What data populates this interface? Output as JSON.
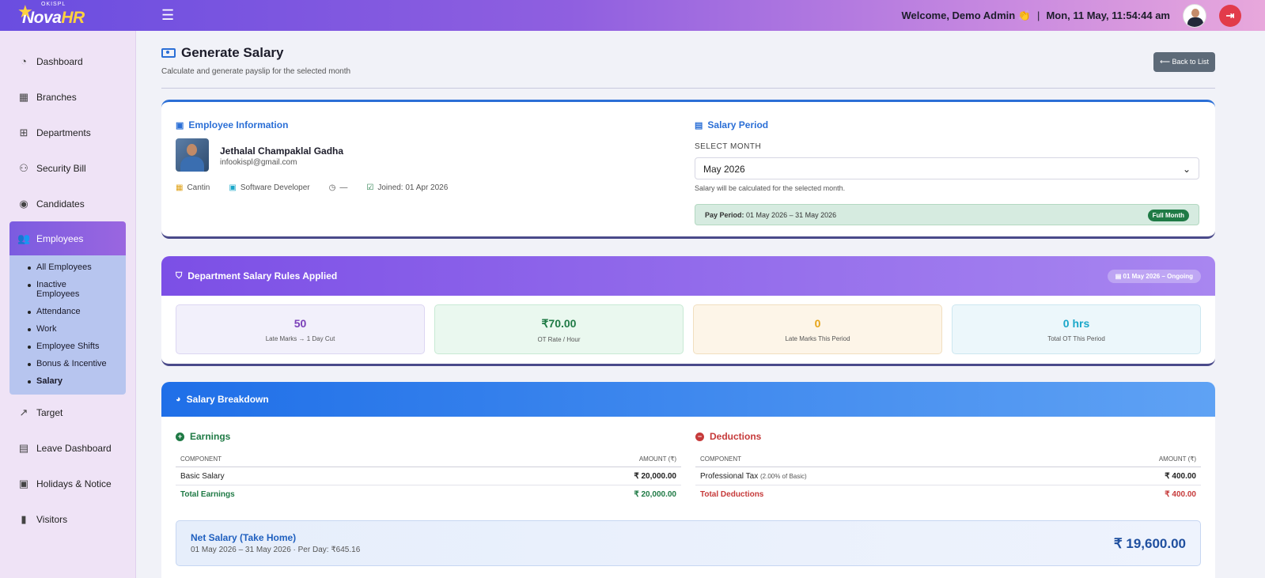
{
  "brand": {
    "top": "OKISPL",
    "name_a": "Nova",
    "name_b": "HR"
  },
  "header": {
    "welcome": "Welcome, Demo Admin 👏",
    "separator": "|",
    "datetime": "Mon, 11 May, 11:54:44 am"
  },
  "sidebar": {
    "items": [
      {
        "label": "Dashboard",
        "icon": "gauge-icon"
      },
      {
        "label": "Branches",
        "icon": "building-icon"
      },
      {
        "label": "Departments",
        "icon": "sitemap-icon"
      },
      {
        "label": "Security Bill",
        "icon": "users-icon"
      },
      {
        "label": "Candidates",
        "icon": "user-circle-icon"
      },
      {
        "label": "Employees",
        "icon": "people-icon"
      },
      {
        "label": "Target",
        "icon": "chart-line-icon"
      },
      {
        "label": "Leave Dashboard",
        "icon": "calendar-icon"
      },
      {
        "label": "Holidays & Notice",
        "icon": "calendar-notice-icon"
      },
      {
        "label": "Visitors",
        "icon": "door-icon"
      }
    ],
    "employees_sub": [
      "All Employees",
      "Inactive Employees",
      "Attendance",
      "Work",
      "Employee Shifts",
      "Bonus & Incentive",
      "Salary"
    ]
  },
  "page": {
    "title": "Generate Salary",
    "subtitle": "Calculate and generate payslip for the selected month",
    "back_label": "Back to List"
  },
  "employee": {
    "section_title": "Employee Information",
    "name": "Jethalal Champaklal Gadha",
    "email": "infookispl@gmail.com",
    "department": "Cantin",
    "designation": "Software Developer",
    "shift": "—",
    "joined": "Joined: 01 Apr 2026"
  },
  "salary_period": {
    "section_title": "Salary Period",
    "select_label": "SELECT MONTH",
    "selected": "May 2026",
    "help": "Salary will be calculated for the selected month.",
    "pay_period_label": "Pay Period:",
    "pay_period_value": "01 May 2026 – 31 May 2026",
    "badge": "Full Month"
  },
  "rules": {
    "title": "Department Salary Rules Applied",
    "badge": "01 May 2026 – Ongoing",
    "stats": [
      {
        "value": "50",
        "label": "Late Marks → 1 Day Cut"
      },
      {
        "value": "₹70.00",
        "label": "OT Rate / Hour"
      },
      {
        "value": "0",
        "label": "Late Marks This Period"
      },
      {
        "value": "0 hrs",
        "label": "Total OT This Period"
      }
    ]
  },
  "breakdown": {
    "title": "Salary Breakdown",
    "earnings": {
      "title": "Earnings",
      "col_component": "COMPONENT",
      "col_amount": "AMOUNT (₹)",
      "rows": [
        {
          "name": "Basic Salary",
          "amount": "₹ 20,000.00"
        }
      ],
      "total_label": "Total Earnings",
      "total": "₹ 20,000.00"
    },
    "deductions": {
      "title": "Deductions",
      "col_component": "COMPONENT",
      "col_amount": "AMOUNT (₹)",
      "rows": [
        {
          "name": "Professional Tax",
          "note": "(2.00% of Basic)",
          "amount": "₹ 400.00"
        }
      ],
      "total_label": "Total Deductions",
      "total": "₹ 400.00"
    },
    "net": {
      "title": "Net Salary (Take Home)",
      "sub": "01 May 2026 – 31 May 2026  ·  Per Day: ₹645.16",
      "amount": "₹ 19,600.00"
    }
  },
  "colors": {
    "accent": "#2b6fd6",
    "purple": "#7c4fe6",
    "green": "#1f7a45",
    "red": "#c63a3a"
  }
}
